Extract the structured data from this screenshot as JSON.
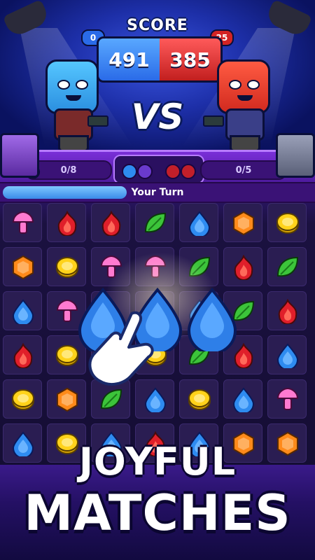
{
  "header": {
    "score_title": "SCORE",
    "blue_score": "491",
    "red_score": "385",
    "blue_pill": "0",
    "red_pill": "25",
    "vs": "VS"
  },
  "hud": {
    "left_progress": "0/8",
    "right_progress": "0/5",
    "turn_label": "Your Turn",
    "turn_progress": 0.4
  },
  "board": {
    "rows": [
      [
        "mushroom",
        "fire",
        "fire",
        "leaf",
        "drop",
        "hexagon",
        "coin"
      ],
      [
        "hexagon",
        "coin",
        "mushroom",
        "mushroom",
        "leaf",
        "fire",
        "leaf"
      ],
      [
        "drop",
        "mushroom",
        "drop",
        "drop",
        "drop",
        "leaf",
        "fire"
      ],
      [
        "fire",
        "coin",
        "hand",
        "coin",
        "leaf",
        "fire",
        "drop"
      ],
      [
        "coin",
        "hexagon",
        "leaf",
        "drop",
        "coin",
        "drop",
        "mushroom"
      ],
      [
        "drop",
        "coin",
        "drop",
        "fire",
        "drop",
        "hexagon",
        "hexagon"
      ]
    ]
  },
  "colors": {
    "mushroom": "#ff7ad0",
    "fire": "#e01f2a",
    "leaf": "#3cc43a",
    "drop": "#2e8bf0",
    "hexagon": "#ff8a1a",
    "coin": "#ffd21a"
  },
  "banner": {
    "line1": "JOYFUL",
    "line2": "MATCHES"
  }
}
